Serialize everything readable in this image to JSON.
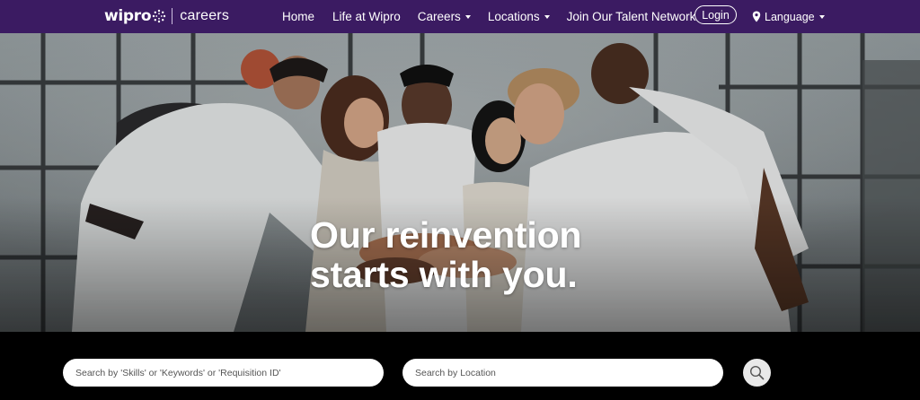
{
  "brand": {
    "logo": "wipro",
    "section": "careers"
  },
  "nav": {
    "items": [
      {
        "label": "Home",
        "dropdown": false
      },
      {
        "label": "Life at Wipro",
        "dropdown": false
      },
      {
        "label": "Careers",
        "dropdown": true
      },
      {
        "label": "Locations",
        "dropdown": true
      },
      {
        "label": "Join Our Talent Network",
        "dropdown": false
      }
    ],
    "login_label": "Login",
    "language_label": "Language"
  },
  "hero": {
    "headline_line1": "Our reinvention",
    "headline_line2": "starts with you."
  },
  "search": {
    "keyword_placeholder": "Search by 'Skills' or 'Keywords' or 'Requisition ID'",
    "location_placeholder": "Search by Location"
  },
  "icons": {
    "nav_dropdown": "chevron-down-icon",
    "language": "map-pin-icon",
    "search": "search-icon"
  },
  "colors": {
    "nav_background": "#3b1b62",
    "search_background": "#000000",
    "search_button": "#e9e9e9"
  }
}
